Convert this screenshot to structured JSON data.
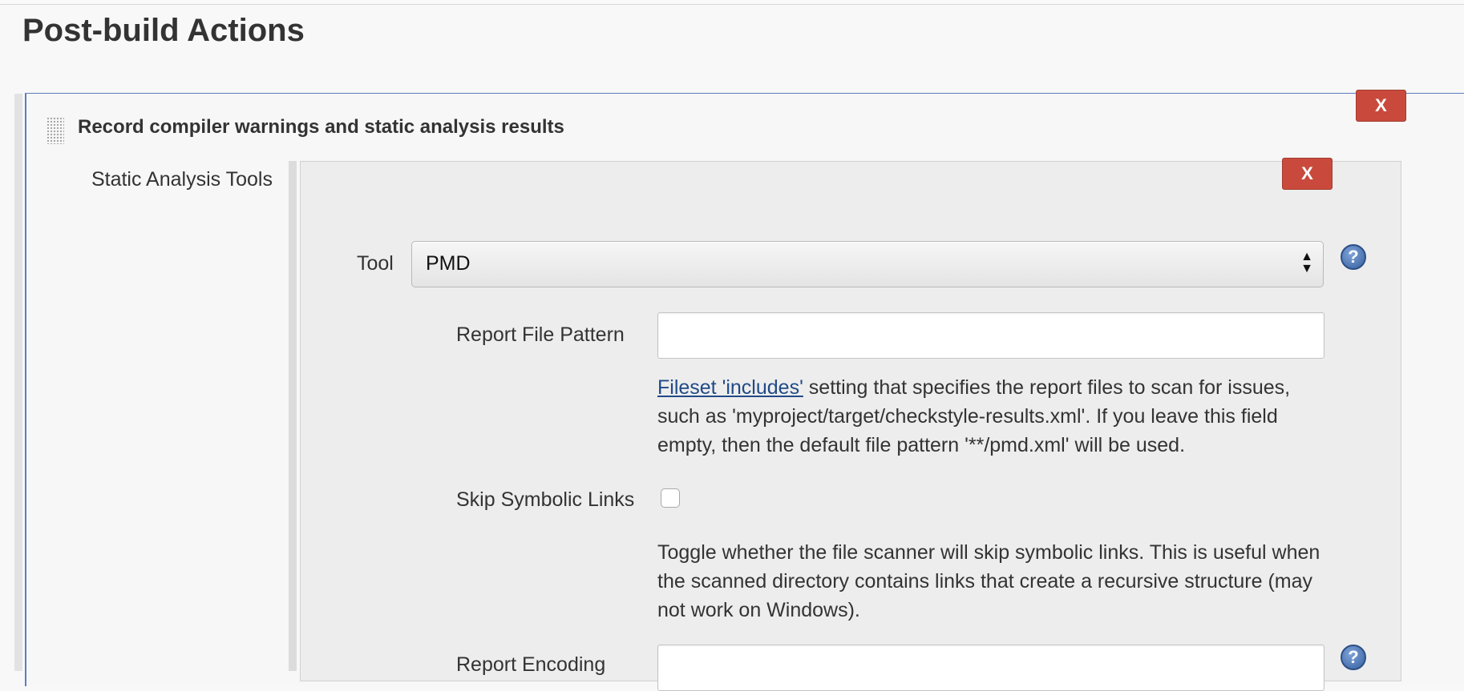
{
  "section": {
    "title": "Post-build Actions"
  },
  "step": {
    "title": "Record compiler warnings and static analysis results",
    "close_label": "X"
  },
  "tools": {
    "label": "Static Analysis Tools",
    "close_label": "X",
    "tool_label": "Tool",
    "tool_selected": "PMD",
    "help_label": "?",
    "report_pattern": {
      "label": "Report File Pattern",
      "value": "",
      "desc_link": "Fileset 'includes'",
      "desc_text": " setting that specifies the report files to scan for issues, such as 'myproject/target/checkstyle-results.xml'. If you leave this field empty, then the default file pattern '**/pmd.xml' will be used."
    },
    "skip_symlinks": {
      "label": "Skip Symbolic Links",
      "checked": false,
      "desc": "Toggle whether the file scanner will skip symbolic links. This is useful when the scanned directory contains links that create a recursive structure (may not work on Windows)."
    },
    "report_encoding": {
      "label": "Report Encoding",
      "value": ""
    }
  },
  "icons": {
    "drag": "drag-handle-icon",
    "help": "help-icon",
    "select_arrows": "select-arrows-icon"
  },
  "colors": {
    "close_button": "#c94a3c",
    "panel_border": "#5d7ebf",
    "link": "#204a87",
    "help_icon": "#35609f"
  }
}
